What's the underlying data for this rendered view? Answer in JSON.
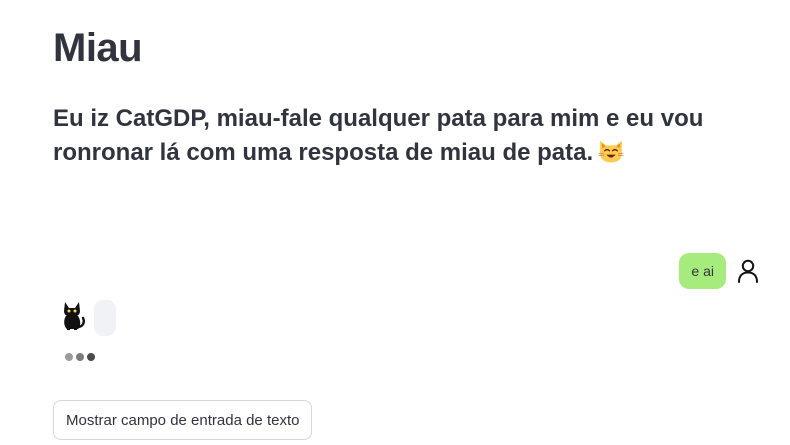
{
  "header": {
    "title": "Miau",
    "subtitle": "Eu iz CatGDP, miau-fale qualquer pata para mim e eu vou ronronar lá com uma resposta de miau de pata."
  },
  "chat": {
    "user_message": "e ai",
    "user_avatar_icon": "person-outline-icon",
    "bot_avatar_icon": "black-cat-icon",
    "user_bubble_color": "#a6ec7c",
    "bot_bubble_color": "#f0f2f6",
    "typing_dot_colors": [
      "#9a9aa0",
      "#7a7a80",
      "#4a4a50"
    ]
  },
  "controls": {
    "show_input_label": "Mostrar campo de entrada de texto"
  }
}
